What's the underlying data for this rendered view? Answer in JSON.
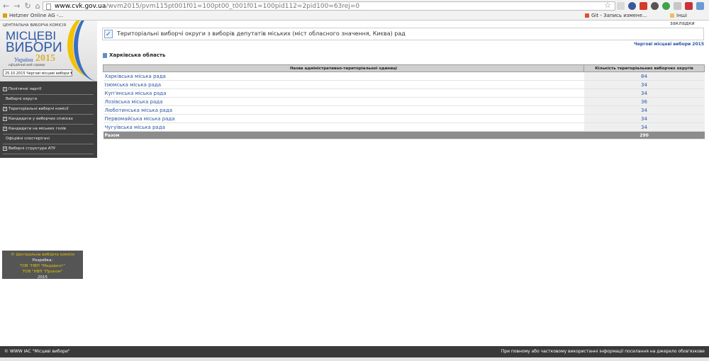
{
  "browser": {
    "url_host": "www.cvk.gov.ua",
    "url_path": "/wvm2015/pvm115pt001f01=100pt00_t001f01=100pid112=2pid100=63rej=0",
    "bookmarks": [
      "Hetzner Online AG -...",
      "Git - Запись измене...",
      "Інші закладки"
    ]
  },
  "logo": {
    "org": "ЦЕНТРАЛЬНА ВИБОРЧА КОМІСІЯ",
    "line1": "МІСЦЕВІ",
    "line2": "ВИБОРИ",
    "country": "Україна",
    "year": "2015",
    "subtitle": "офіційний веб-сервер"
  },
  "election_select": "25.10.2015 Чергові місцеві вибори",
  "menu": [
    {
      "label": "Політичні партії",
      "expandable": true
    },
    {
      "label": "Виборчі округи",
      "expandable": false
    },
    {
      "label": "Територіальні виборчі комісії",
      "expandable": true
    },
    {
      "label": "Кандидати у виборчих списках",
      "expandable": true
    },
    {
      "label": "Кандидати на міських голів",
      "expandable": true
    },
    {
      "label": "Офіційні спостерігачі",
      "expandable": false
    },
    {
      "label": "Виборчі структури АТУ",
      "expandable": true
    }
  ],
  "credits": {
    "copyright": "© Центральна виборча комісія",
    "dev_label": "Розробка:",
    "dev1": "ТОВ \"НВП \"Медирент\"",
    "dev2": "ТОВ \"НВП \"Проком\"",
    "year": "2015"
  },
  "page": {
    "title": "Територіальні виборчі округи з виборів депутатів міських (міст обласного значення, Києва) рад",
    "election_label": "Чергові місцеві вибори 2015",
    "region": "Харківська область"
  },
  "table": {
    "headers": [
      "Назва адміністративно-територіальної одиниці",
      "Кількість територіальних виборчих округів"
    ],
    "rows": [
      {
        "name": "Харківська міська рада",
        "count": "84"
      },
      {
        "name": "Ізюмська міська рада",
        "count": "34"
      },
      {
        "name": "Куп'янська міська рада",
        "count": "34"
      },
      {
        "name": "Лозівська міська рада",
        "count": "36"
      },
      {
        "name": "Люботинська міська рада",
        "count": "34"
      },
      {
        "name": "Первомайська міська рада",
        "count": "34"
      },
      {
        "name": "Чугуївська міська рада",
        "count": "34"
      }
    ],
    "total_label": "Разом",
    "total_value": "290"
  },
  "footer": {
    "left": "© WWW ІАС \"Місцеві вибори\"",
    "right": "При повному або частковому використанні інформації посилання на джерело обов'язкове"
  },
  "colors": {
    "link": "#2b57a6",
    "sidebar": "#3f3f3f",
    "accent_yellow": "#f2c200"
  }
}
